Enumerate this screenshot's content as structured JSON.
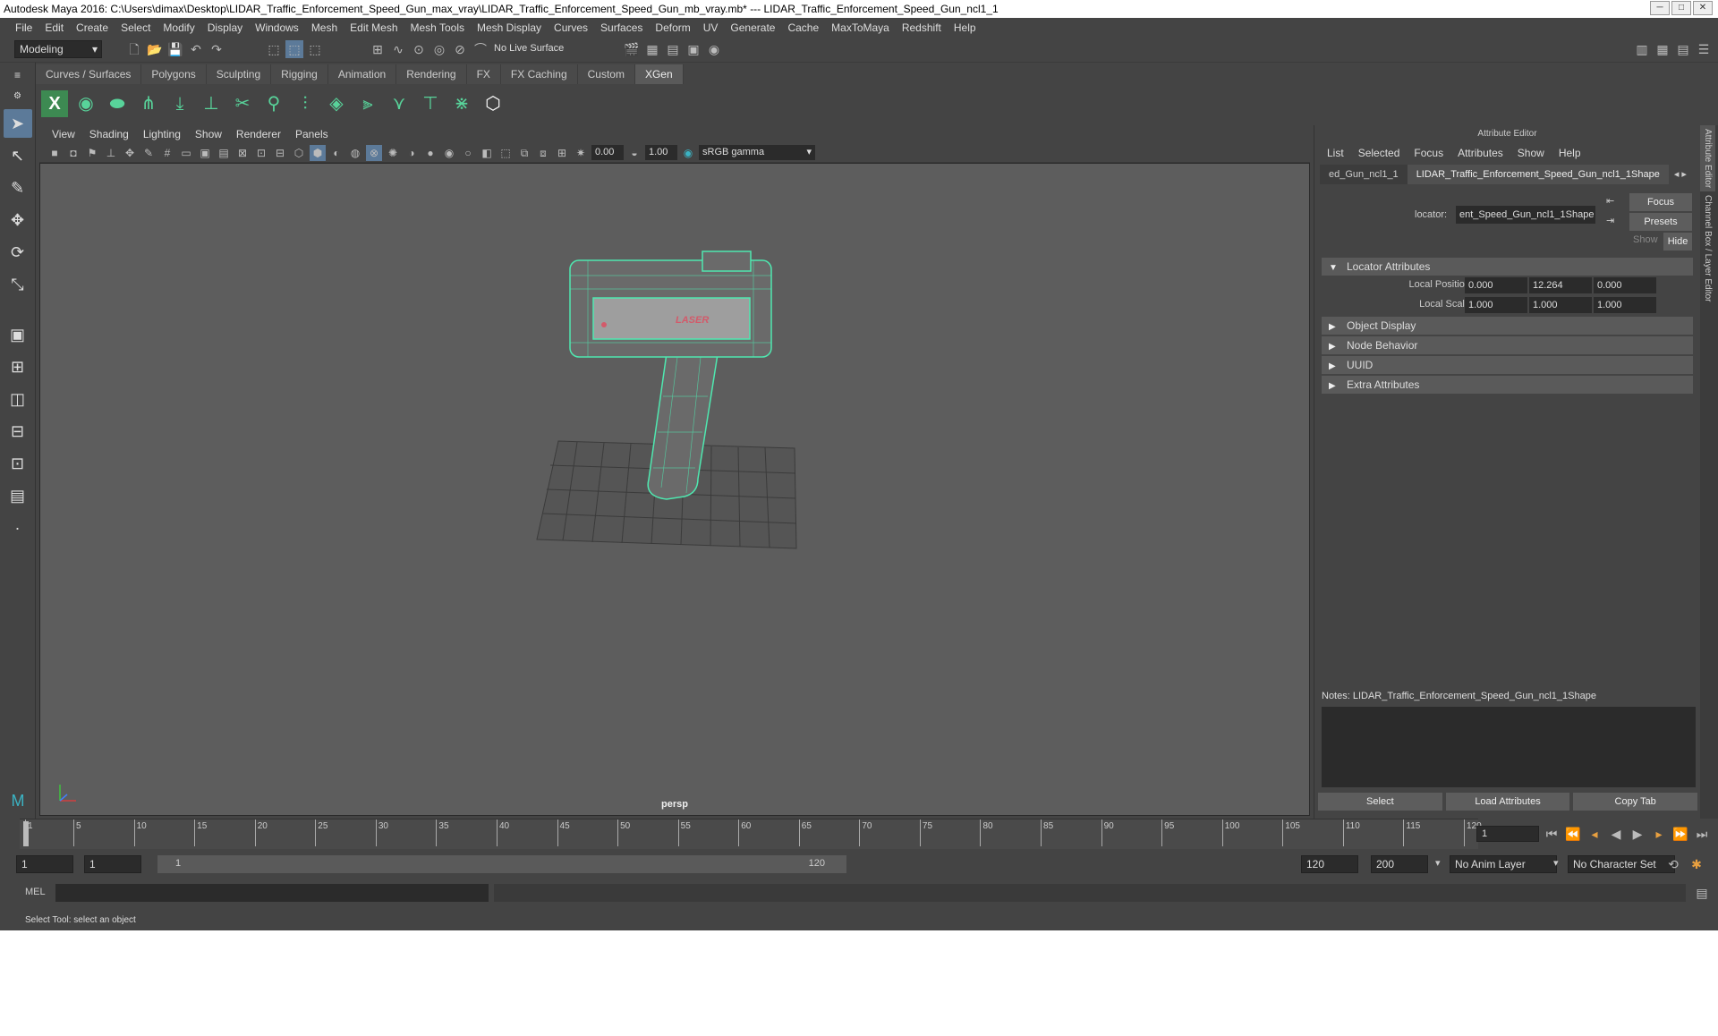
{
  "window": {
    "title": "Autodesk Maya 2016: C:\\Users\\dimax\\Desktop\\LIDAR_Traffic_Enforcement_Speed_Gun_max_vray\\LIDAR_Traffic_Enforcement_Speed_Gun_mb_vray.mb*   ---   LIDAR_Traffic_Enforcement_Speed_Gun_ncl1_1",
    "minimize": "─",
    "maximize": "□",
    "close": "✕"
  },
  "menubar": [
    "File",
    "Edit",
    "Create",
    "Select",
    "Modify",
    "Display",
    "Windows",
    "Mesh",
    "Edit Mesh",
    "Mesh Tools",
    "Mesh Display",
    "Curves",
    "Surfaces",
    "Deform",
    "UV",
    "Generate",
    "Cache",
    "MaxToMaya",
    "Redshift",
    "Help"
  ],
  "statusline": {
    "mode": "Modeling",
    "live_surface": "No Live Surface"
  },
  "shelf": {
    "tabs": [
      "Curves / Surfaces",
      "Polygons",
      "Sculpting",
      "Rigging",
      "Animation",
      "Rendering",
      "FX",
      "FX Caching",
      "Custom",
      "XGen"
    ],
    "active_tab": "XGen",
    "icons": [
      "xgen-icon",
      "eye-icon",
      "leaf-icon",
      "grow-icon",
      "comb-icon",
      "length-icon",
      "cut-icon",
      "pin-icon",
      "noise-icon",
      "layers-icon",
      "clump-icon",
      "brush-icon",
      "smooth-icon",
      "select-guides-icon",
      "hex-icon"
    ]
  },
  "viewport": {
    "menus": [
      "View",
      "Shading",
      "Lighting",
      "Show",
      "Renderer",
      "Panels"
    ],
    "exposure": "0.00",
    "gamma": "1.00",
    "color_space": "sRGB gamma",
    "camera": "persp"
  },
  "attribute_editor": {
    "title": "Attribute Editor",
    "menus": [
      "List",
      "Selected",
      "Focus",
      "Attributes",
      "Show",
      "Help"
    ],
    "tabs": [
      "ed_Gun_ncl1_1",
      "LIDAR_Traffic_Enforcement_Speed_Gun_ncl1_1Shape"
    ],
    "active_tab": 1,
    "node_type_label": "locator:",
    "node_name": "ent_Speed_Gun_ncl1_1Shape",
    "focus_label": "Focus",
    "presets_label": "Presets",
    "show_label": "Show",
    "hide_label": "Hide",
    "sections": [
      {
        "label": "Locator Attributes",
        "expanded": true
      },
      {
        "label": "Object Display",
        "expanded": false
      },
      {
        "label": "Node Behavior",
        "expanded": false
      },
      {
        "label": "UUID",
        "expanded": false
      },
      {
        "label": "Extra Attributes",
        "expanded": false
      }
    ],
    "local_position": {
      "label": "Local Position",
      "x": "0.000",
      "y": "12.264",
      "z": "0.000"
    },
    "local_scale": {
      "label": "Local Scale",
      "x": "1.000",
      "y": "1.000",
      "z": "1.000"
    },
    "notes_label": "Notes:  LIDAR_Traffic_Enforcement_Speed_Gun_ncl1_1Shape",
    "buttons": [
      "Select",
      "Load Attributes",
      "Copy Tab"
    ],
    "side_tabs": [
      "Attribute Editor",
      "Channel Box / Layer Editor"
    ]
  },
  "timeslider": {
    "ticks": [
      "1",
      "5",
      "10",
      "15",
      "20",
      "25",
      "30",
      "35",
      "40",
      "45",
      "50",
      "55",
      "60",
      "65",
      "70",
      "75",
      "80",
      "85",
      "90",
      "95",
      "100",
      "105",
      "110",
      "115",
      "120"
    ],
    "current_frame": "1"
  },
  "range": {
    "start": "1",
    "playback_start": "1",
    "range_start_label": "1",
    "range_end_label": "120",
    "playback_end": "120",
    "end": "200",
    "anim_layer": "No Anim Layer",
    "character_set": "No Character Set"
  },
  "cmdline": {
    "lang": "MEL"
  },
  "helpline": "Select Tool: select an object",
  "model_label": "LASER"
}
